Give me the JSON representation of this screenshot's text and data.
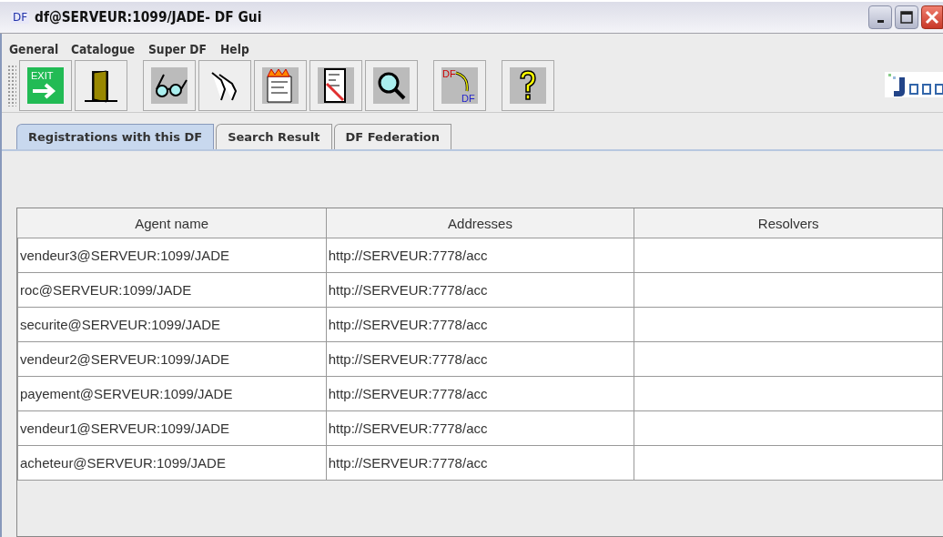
{
  "window": {
    "icon_text": "DF",
    "title": "df@SERVEUR:1099/JADE- DF Gui"
  },
  "menu": [
    "General",
    "Catalogue",
    "Super DF",
    "Help"
  ],
  "toolbar_groups": [
    [
      {
        "kind": "exit",
        "text": "EXIT"
      },
      {
        "kind": "door"
      }
    ],
    [
      {
        "kind": "glasses"
      },
      {
        "kind": "hand"
      },
      {
        "kind": "burning-page"
      },
      {
        "kind": "edit-page"
      },
      {
        "kind": "magnifier"
      }
    ],
    [
      {
        "kind": "federate",
        "texts": [
          "DF",
          "DF"
        ]
      }
    ],
    [
      {
        "kind": "help"
      }
    ]
  ],
  "tabs": [
    {
      "label": "Registrations with this DF",
      "selected": true
    },
    {
      "label": "Search Result",
      "selected": false
    },
    {
      "label": "DF Federation",
      "selected": false
    }
  ],
  "table": {
    "columns": [
      "Agent name",
      "Addresses",
      "Resolvers"
    ],
    "rows": [
      [
        "vendeur3@SERVEUR:1099/JADE",
        "http://SERVEUR:7778/acc",
        ""
      ],
      [
        "roc@SERVEUR:1099/JADE",
        "http://SERVEUR:7778/acc",
        ""
      ],
      [
        "securite@SERVEUR:1099/JADE",
        "http://SERVEUR:7778/acc",
        ""
      ],
      [
        "vendeur2@SERVEUR:1099/JADE",
        "http://SERVEUR:7778/acc",
        ""
      ],
      [
        "payement@SERVEUR:1099/JADE",
        "http://SERVEUR:7778/acc",
        ""
      ],
      [
        "vendeur1@SERVEUR:1099/JADE",
        "http://SERVEUR:7778/acc",
        ""
      ],
      [
        "acheteur@SERVEUR:1099/JADE",
        "http://SERVEUR:7778/acc",
        ""
      ]
    ]
  }
}
